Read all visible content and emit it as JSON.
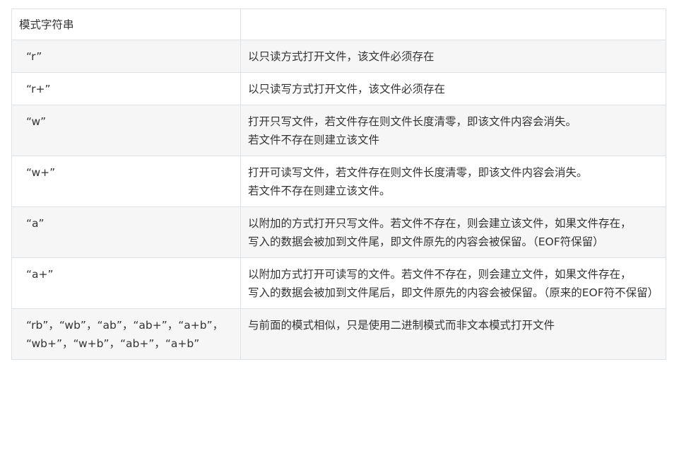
{
  "table": {
    "header": {
      "col1": "模式字符串",
      "col2": ""
    },
    "rows": [
      {
        "mode": "“r”",
        "desc": "以只读方式打开文件，该文件必须存在"
      },
      {
        "mode": "“r+”",
        "desc": "以只读写方式打开文件，该文件必须存在"
      },
      {
        "mode": "“w”",
        "desc": "打开只写文件，若文件存在则文件长度清零，即该文件内容会消失。\n若文件不存在则建立该文件"
      },
      {
        "mode": "“w+”",
        "desc": "打开可读写文件，若文件存在则文件长度清零，即该文件内容会消失。\n若文件不存在则建立该文件。"
      },
      {
        "mode": "“a”",
        "desc": "以附加的方式打开只写文件。若文件不存在，则会建立该文件，如果文件存在，\n写入的数据会被加到文件尾，即文件原先的内容会被保留。（EOF符保留）"
      },
      {
        "mode": "“a+”",
        "desc": "以附加方式打开可读写的文件。若文件不存在，则会建立文件，如果文件存在，\n写入的数据会被加到文件尾后，即文件原先的内容会被保留。（原来的EOF符不保留）"
      },
      {
        "mode": "“rb”，“wb”，“ab”，“ab+”，“a+b”，\n“wb+”，“w+b”，“ab+”，“a+b”",
        "desc": "与前面的模式相似，只是使用二进制模式而非文本模式打开文件"
      }
    ]
  }
}
